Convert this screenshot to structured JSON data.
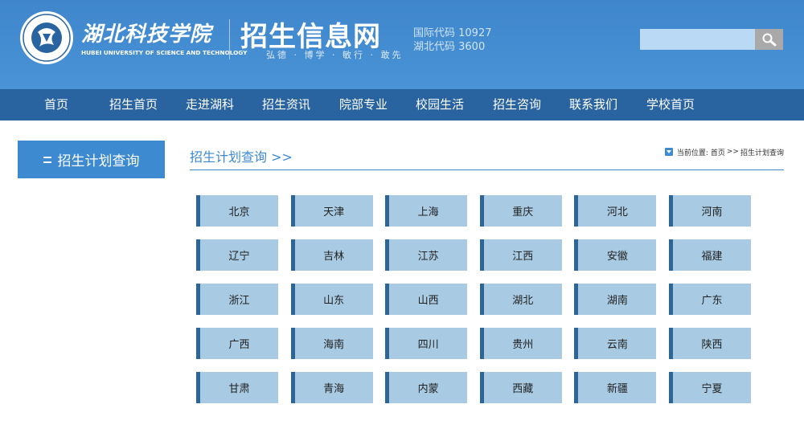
{
  "header": {
    "university_name_cn": "湖北科技学院",
    "university_name_en": "HUBEI UNIVERSITY OF SCIENCE AND TECHNOLOGY",
    "site_title": "招生信息网",
    "motto": "弘德 · 博学 · 敏行 · 敢先",
    "code_international": "国际代码 10927",
    "code_hubei": "湖北代码 3600",
    "search": {
      "value": "",
      "placeholder": ""
    }
  },
  "nav": {
    "items": [
      {
        "label": "首页"
      },
      {
        "label": "招生首页"
      },
      {
        "label": "走进湖科"
      },
      {
        "label": "招生资讯"
      },
      {
        "label": "院部专业"
      },
      {
        "label": "校园生活"
      },
      {
        "label": "招生咨询"
      },
      {
        "label": "联系我们"
      },
      {
        "label": "学校首页"
      }
    ]
  },
  "sidebar": {
    "title": "招生计划查询"
  },
  "content": {
    "title": "招生计划查询 >>",
    "breadcrumb": {
      "prefix": "当前位置:",
      "home": "首页",
      "separator": ">>",
      "current": "招生计划查询"
    }
  },
  "provinces": [
    "北京",
    "天津",
    "上海",
    "重庆",
    "河北",
    "河南",
    "辽宁",
    "吉林",
    "江苏",
    "江西",
    "安徽",
    "福建",
    "浙江",
    "山东",
    "山西",
    "湖北",
    "湖南",
    "广东",
    "广西",
    "海南",
    "四川",
    "贵州",
    "云南",
    "陕西",
    "甘肃",
    "青海",
    "内蒙",
    "西藏",
    "新疆",
    "宁夏"
  ],
  "colors": {
    "header_bg": "#4a93d6",
    "nav_bg": "#2a64a0",
    "accent": "#3d8ad1",
    "province_bg": "#a8cbe3",
    "province_border": "#2e6597",
    "search_bg": "#b9d9f4",
    "search_button": "#a9a9a9"
  }
}
